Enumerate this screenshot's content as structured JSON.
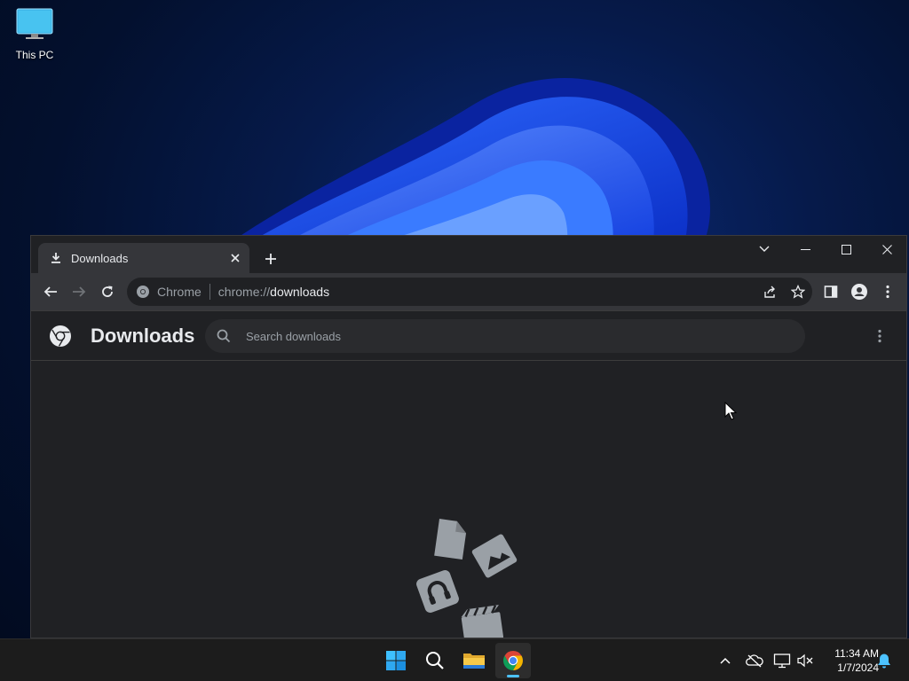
{
  "desktop": {
    "icons": [
      {
        "label": "This PC",
        "icon": "monitor-icon"
      }
    ]
  },
  "browser": {
    "tab": {
      "title": "Downloads",
      "icon": "download-icon"
    },
    "omnibox": {
      "chip_label": "Chrome",
      "url_scheme": "chrome://",
      "url_host": "downloads"
    }
  },
  "downloads_page": {
    "title": "Downloads",
    "search_placeholder": "Search downloads"
  },
  "taskbar": {
    "apps": [
      "start-icon",
      "search-icon",
      "file-explorer-icon",
      "chrome-icon"
    ],
    "clock": {
      "time": "11:34 AM",
      "date": "1/7/2024"
    }
  },
  "colors": {
    "accent": "#4cc2ff",
    "window_bg": "#202124",
    "toolbar_bg": "#35363a"
  }
}
